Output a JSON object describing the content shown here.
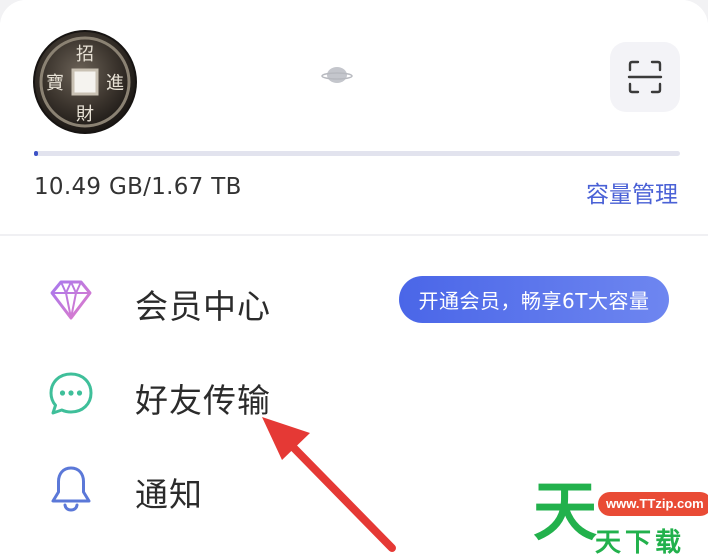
{
  "header": {
    "storage_text": "10.49 GB/1.67 TB",
    "manage_label": "容量管理",
    "storage_used_fraction": 0.006
  },
  "avatar": {
    "coin_chars": [
      "招",
      "財",
      "寶",
      "進"
    ]
  },
  "menu": {
    "items": [
      {
        "label": "会员中心",
        "icon": "diamond-icon"
      },
      {
        "label": "好友传输",
        "icon": "chat-bubble-icon"
      },
      {
        "label": "通知",
        "icon": "bell-icon"
      }
    ],
    "vip_badge": "开通会员，畅享6T大容量"
  },
  "watermark": {
    "big_char": "天",
    "url": "www.TTzip.com",
    "text": "天下载"
  },
  "colors": {
    "accent": "#4a61d6",
    "arrow": "#e53935",
    "watermark_green": "#22b14c"
  }
}
